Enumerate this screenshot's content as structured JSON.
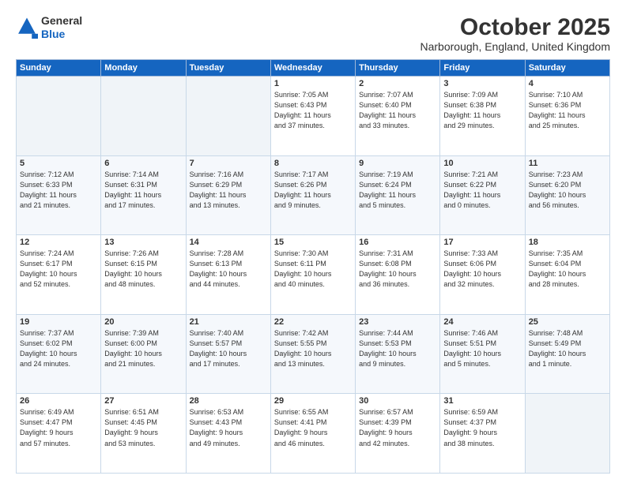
{
  "header": {
    "logo_line1": "General",
    "logo_line2": "Blue",
    "title": "October 2025",
    "subtitle": "Narborough, England, United Kingdom"
  },
  "weekdays": [
    "Sunday",
    "Monday",
    "Tuesday",
    "Wednesday",
    "Thursday",
    "Friday",
    "Saturday"
  ],
  "weeks": [
    [
      {
        "day": "",
        "info": ""
      },
      {
        "day": "",
        "info": ""
      },
      {
        "day": "",
        "info": ""
      },
      {
        "day": "1",
        "info": "Sunrise: 7:05 AM\nSunset: 6:43 PM\nDaylight: 11 hours\nand 37 minutes."
      },
      {
        "day": "2",
        "info": "Sunrise: 7:07 AM\nSunset: 6:40 PM\nDaylight: 11 hours\nand 33 minutes."
      },
      {
        "day": "3",
        "info": "Sunrise: 7:09 AM\nSunset: 6:38 PM\nDaylight: 11 hours\nand 29 minutes."
      },
      {
        "day": "4",
        "info": "Sunrise: 7:10 AM\nSunset: 6:36 PM\nDaylight: 11 hours\nand 25 minutes."
      }
    ],
    [
      {
        "day": "5",
        "info": "Sunrise: 7:12 AM\nSunset: 6:33 PM\nDaylight: 11 hours\nand 21 minutes."
      },
      {
        "day": "6",
        "info": "Sunrise: 7:14 AM\nSunset: 6:31 PM\nDaylight: 11 hours\nand 17 minutes."
      },
      {
        "day": "7",
        "info": "Sunrise: 7:16 AM\nSunset: 6:29 PM\nDaylight: 11 hours\nand 13 minutes."
      },
      {
        "day": "8",
        "info": "Sunrise: 7:17 AM\nSunset: 6:26 PM\nDaylight: 11 hours\nand 9 minutes."
      },
      {
        "day": "9",
        "info": "Sunrise: 7:19 AM\nSunset: 6:24 PM\nDaylight: 11 hours\nand 5 minutes."
      },
      {
        "day": "10",
        "info": "Sunrise: 7:21 AM\nSunset: 6:22 PM\nDaylight: 11 hours\nand 0 minutes."
      },
      {
        "day": "11",
        "info": "Sunrise: 7:23 AM\nSunset: 6:20 PM\nDaylight: 10 hours\nand 56 minutes."
      }
    ],
    [
      {
        "day": "12",
        "info": "Sunrise: 7:24 AM\nSunset: 6:17 PM\nDaylight: 10 hours\nand 52 minutes."
      },
      {
        "day": "13",
        "info": "Sunrise: 7:26 AM\nSunset: 6:15 PM\nDaylight: 10 hours\nand 48 minutes."
      },
      {
        "day": "14",
        "info": "Sunrise: 7:28 AM\nSunset: 6:13 PM\nDaylight: 10 hours\nand 44 minutes."
      },
      {
        "day": "15",
        "info": "Sunrise: 7:30 AM\nSunset: 6:11 PM\nDaylight: 10 hours\nand 40 minutes."
      },
      {
        "day": "16",
        "info": "Sunrise: 7:31 AM\nSunset: 6:08 PM\nDaylight: 10 hours\nand 36 minutes."
      },
      {
        "day": "17",
        "info": "Sunrise: 7:33 AM\nSunset: 6:06 PM\nDaylight: 10 hours\nand 32 minutes."
      },
      {
        "day": "18",
        "info": "Sunrise: 7:35 AM\nSunset: 6:04 PM\nDaylight: 10 hours\nand 28 minutes."
      }
    ],
    [
      {
        "day": "19",
        "info": "Sunrise: 7:37 AM\nSunset: 6:02 PM\nDaylight: 10 hours\nand 24 minutes."
      },
      {
        "day": "20",
        "info": "Sunrise: 7:39 AM\nSunset: 6:00 PM\nDaylight: 10 hours\nand 21 minutes."
      },
      {
        "day": "21",
        "info": "Sunrise: 7:40 AM\nSunset: 5:57 PM\nDaylight: 10 hours\nand 17 minutes."
      },
      {
        "day": "22",
        "info": "Sunrise: 7:42 AM\nSunset: 5:55 PM\nDaylight: 10 hours\nand 13 minutes."
      },
      {
        "day": "23",
        "info": "Sunrise: 7:44 AM\nSunset: 5:53 PM\nDaylight: 10 hours\nand 9 minutes."
      },
      {
        "day": "24",
        "info": "Sunrise: 7:46 AM\nSunset: 5:51 PM\nDaylight: 10 hours\nand 5 minutes."
      },
      {
        "day": "25",
        "info": "Sunrise: 7:48 AM\nSunset: 5:49 PM\nDaylight: 10 hours\nand 1 minute."
      }
    ],
    [
      {
        "day": "26",
        "info": "Sunrise: 6:49 AM\nSunset: 4:47 PM\nDaylight: 9 hours\nand 57 minutes."
      },
      {
        "day": "27",
        "info": "Sunrise: 6:51 AM\nSunset: 4:45 PM\nDaylight: 9 hours\nand 53 minutes."
      },
      {
        "day": "28",
        "info": "Sunrise: 6:53 AM\nSunset: 4:43 PM\nDaylight: 9 hours\nand 49 minutes."
      },
      {
        "day": "29",
        "info": "Sunrise: 6:55 AM\nSunset: 4:41 PM\nDaylight: 9 hours\nand 46 minutes."
      },
      {
        "day": "30",
        "info": "Sunrise: 6:57 AM\nSunset: 4:39 PM\nDaylight: 9 hours\nand 42 minutes."
      },
      {
        "day": "31",
        "info": "Sunrise: 6:59 AM\nSunset: 4:37 PM\nDaylight: 9 hours\nand 38 minutes."
      },
      {
        "day": "",
        "info": ""
      }
    ]
  ]
}
